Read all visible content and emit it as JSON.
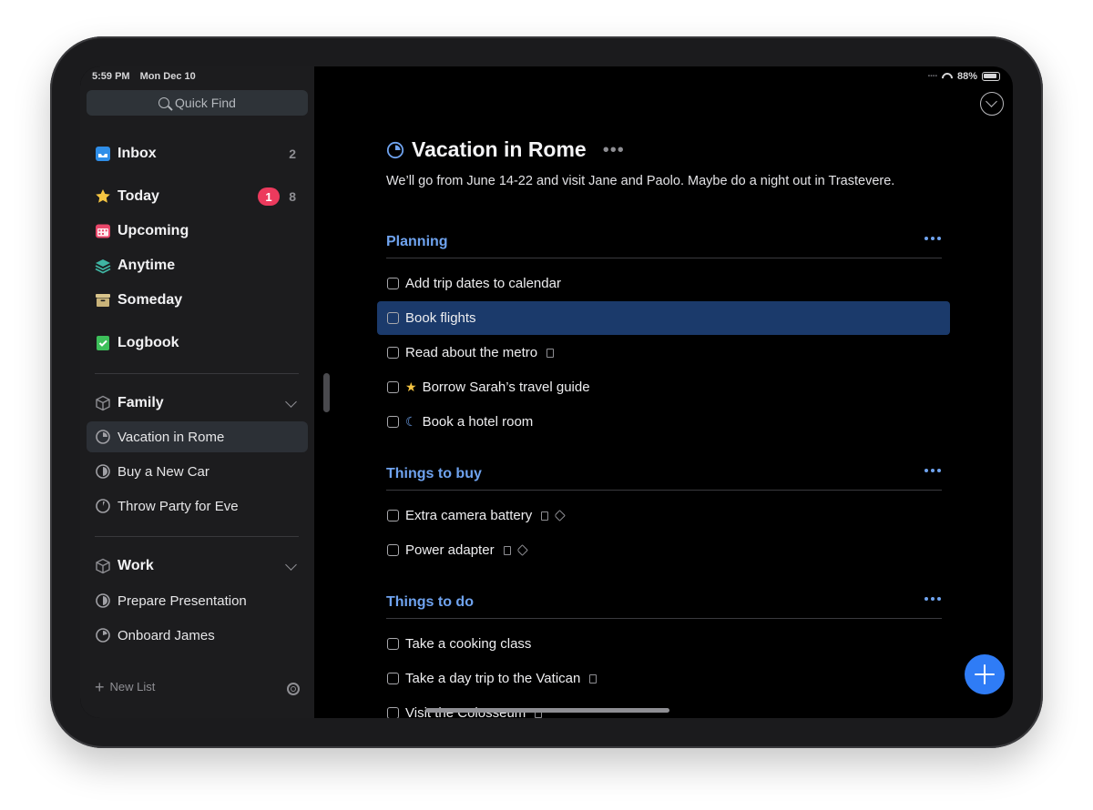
{
  "status": {
    "time": "5:59 PM",
    "date": "Mon Dec 10",
    "battery": "88%"
  },
  "sidebar": {
    "quick_find": "Quick Find",
    "items": [
      {
        "label": "Inbox",
        "count": "2",
        "icon": "inbox-icon"
      },
      {
        "label": "Today",
        "badge": "1",
        "count": "8",
        "icon": "star-icon"
      },
      {
        "label": "Upcoming",
        "icon": "calendar-icon"
      },
      {
        "label": "Anytime",
        "icon": "layers-icon"
      },
      {
        "label": "Someday",
        "icon": "archive-box-icon"
      },
      {
        "label": "Logbook",
        "icon": "logbook-icon"
      }
    ],
    "areas": [
      {
        "label": "Family",
        "projects": [
          "Vacation in Rome",
          "Buy a New Car",
          "Throw Party for Eve"
        ]
      },
      {
        "label": "Work",
        "projects": [
          "Prepare Presentation",
          "Onboard James"
        ]
      }
    ],
    "new_list": "New List"
  },
  "project": {
    "title": "Vacation in Rome",
    "notes": "We’ll go from June 14-22 and visit Jane and Paolo. Maybe do a night out in Trastevere.",
    "headings": [
      {
        "label": "Planning",
        "todos": [
          {
            "text": "Add trip dates to calendar"
          },
          {
            "text": "Book flights",
            "selected": true
          },
          {
            "text": "Read about the metro",
            "note": true
          },
          {
            "text": "Borrow Sarah’s travel guide",
            "star": true
          },
          {
            "text": "Book a hotel room",
            "moon": true
          }
        ]
      },
      {
        "label": "Things to buy",
        "todos": [
          {
            "text": "Extra camera battery",
            "note": true,
            "tag": true
          },
          {
            "text": "Power adapter",
            "note": true,
            "tag": true
          }
        ]
      },
      {
        "label": "Things to do",
        "todos": [
          {
            "text": "Take a cooking class"
          },
          {
            "text": "Take a day trip to the Vatican",
            "note": true
          },
          {
            "text": "Visit the Colosseum",
            "note": true
          }
        ]
      }
    ]
  },
  "colors": {
    "accent": "#6fa3ef",
    "fab": "#2f7cf6",
    "badge": "#ec3a5d",
    "selection": "#1b3a6b"
  }
}
